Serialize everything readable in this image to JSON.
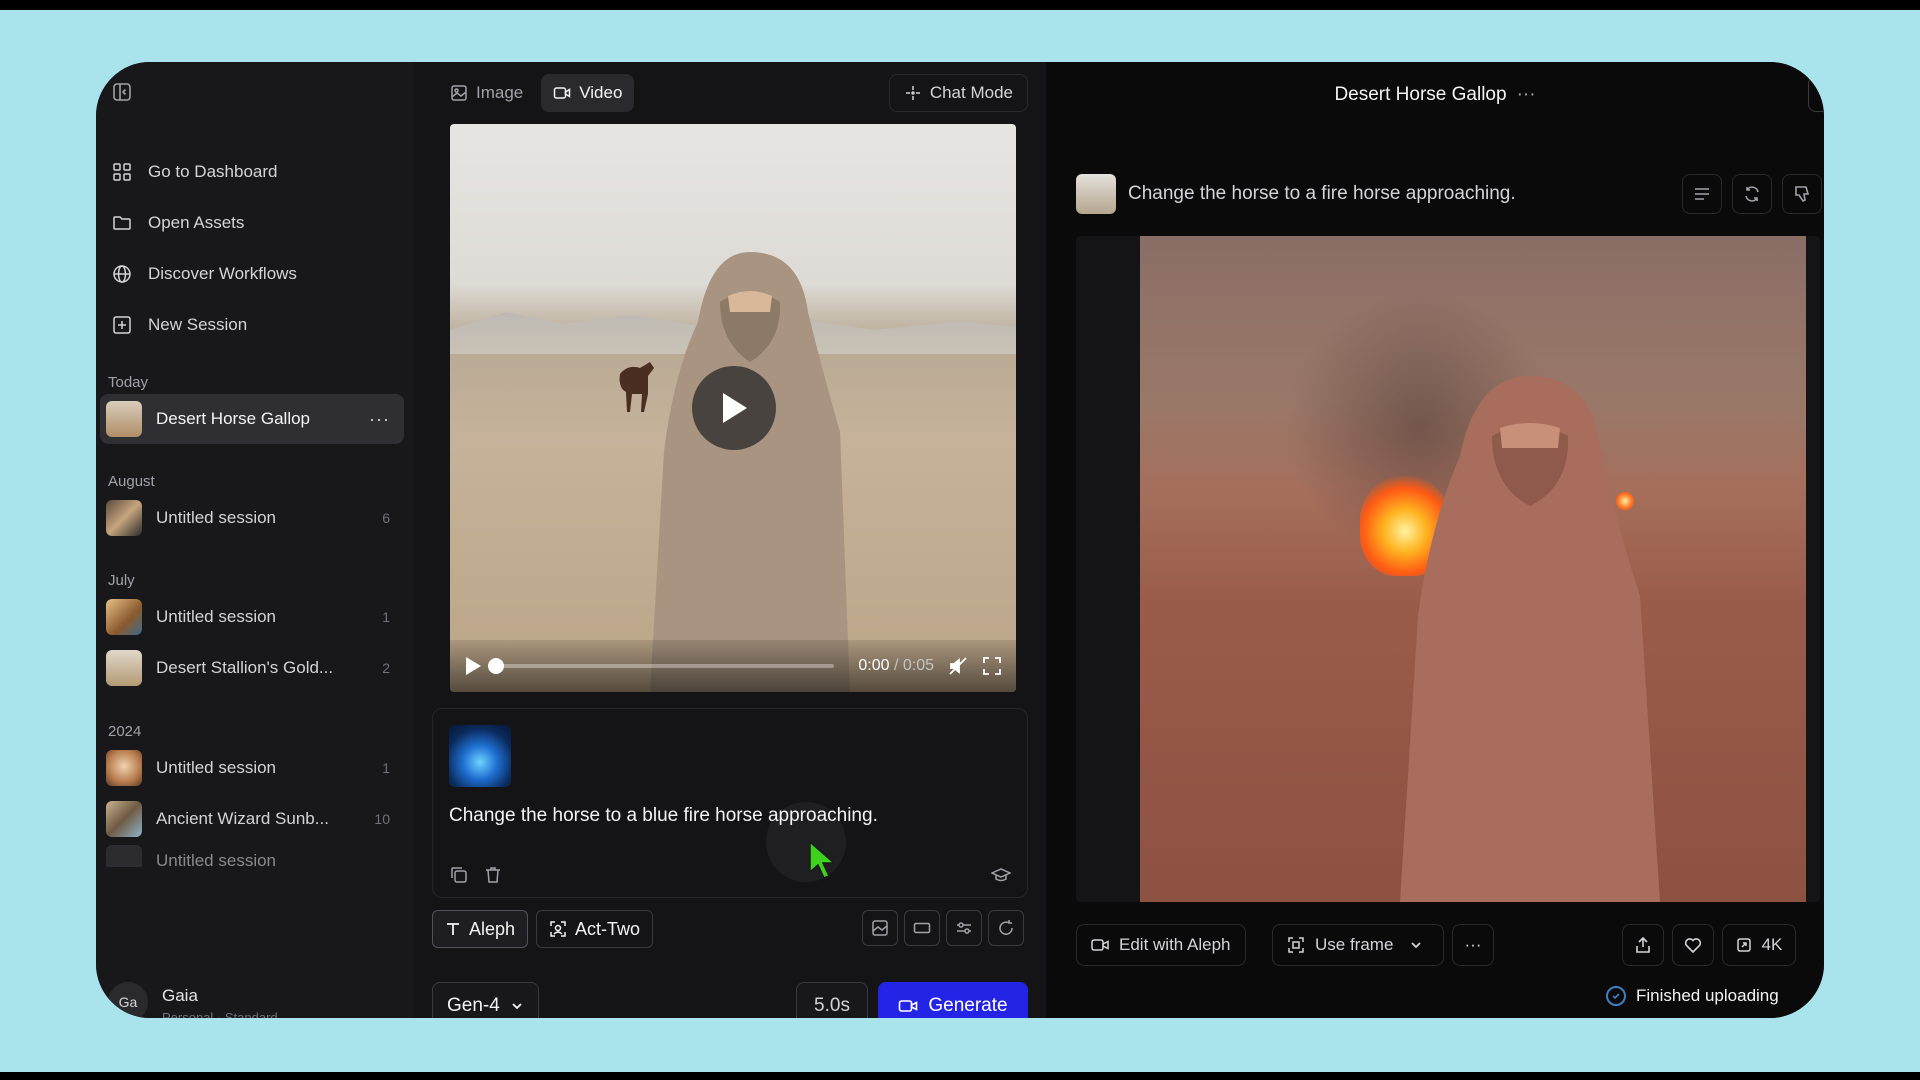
{
  "sidebar": {
    "nav": [
      {
        "label": "Go to Dashboard",
        "icon": "grid-icon"
      },
      {
        "label": "Open Assets",
        "icon": "folder-icon"
      },
      {
        "label": "Discover Workflows",
        "icon": "globe-icon"
      },
      {
        "label": "New Session",
        "icon": "plus-square-icon"
      }
    ],
    "sections": {
      "today": "Today",
      "august": "August",
      "july": "July",
      "year2024": "2024"
    },
    "sessions": {
      "desert_horse": {
        "name": "Desert Horse Gallop",
        "more": "···"
      },
      "aug_untitled": {
        "name": "Untitled session",
        "count": "6"
      },
      "jul_untitled": {
        "name": "Untitled session",
        "count": "1"
      },
      "jul_stallion": {
        "name": "Desert Stallion's Gold...",
        "count": "2"
      },
      "y24_untitled": {
        "name": "Untitled session",
        "count": "1"
      },
      "y24_wizard": {
        "name": "Ancient Wizard Sunb...",
        "count": "10"
      },
      "y24_partial": {
        "name": "Untitled session"
      }
    },
    "user": {
      "initials": "Ga",
      "name": "Gaia",
      "plan": "Personal · Standard"
    }
  },
  "middle": {
    "tabs": {
      "image": "Image",
      "video": "Video"
    },
    "chat_mode": "Chat Mode",
    "player": {
      "current_time": "0:00",
      "separator": " / ",
      "duration": "0:05",
      "progress": 0
    },
    "prompt": "Change the horse to a blue fire horse approaching.",
    "chips": {
      "aleph": "Aleph",
      "act_two": "Act-Two"
    },
    "model": "Gen-4",
    "duration": "5.0s",
    "generate": "Generate"
  },
  "right": {
    "title": "Desert Horse Gallop",
    "title_more": "···",
    "message": "Change the horse to a fire horse approaching.",
    "toolbar": {
      "edit": "Edit with Aleph",
      "use_frame": "Use frame",
      "more": "···",
      "upscale": "4K"
    },
    "status": "Finished uploading"
  },
  "colors": {
    "accent": "#2424e6",
    "background": "#0c0c0e",
    "sidebar": "#18181b",
    "frame": "#a9e4ec",
    "cursor": "#3cd21e"
  }
}
